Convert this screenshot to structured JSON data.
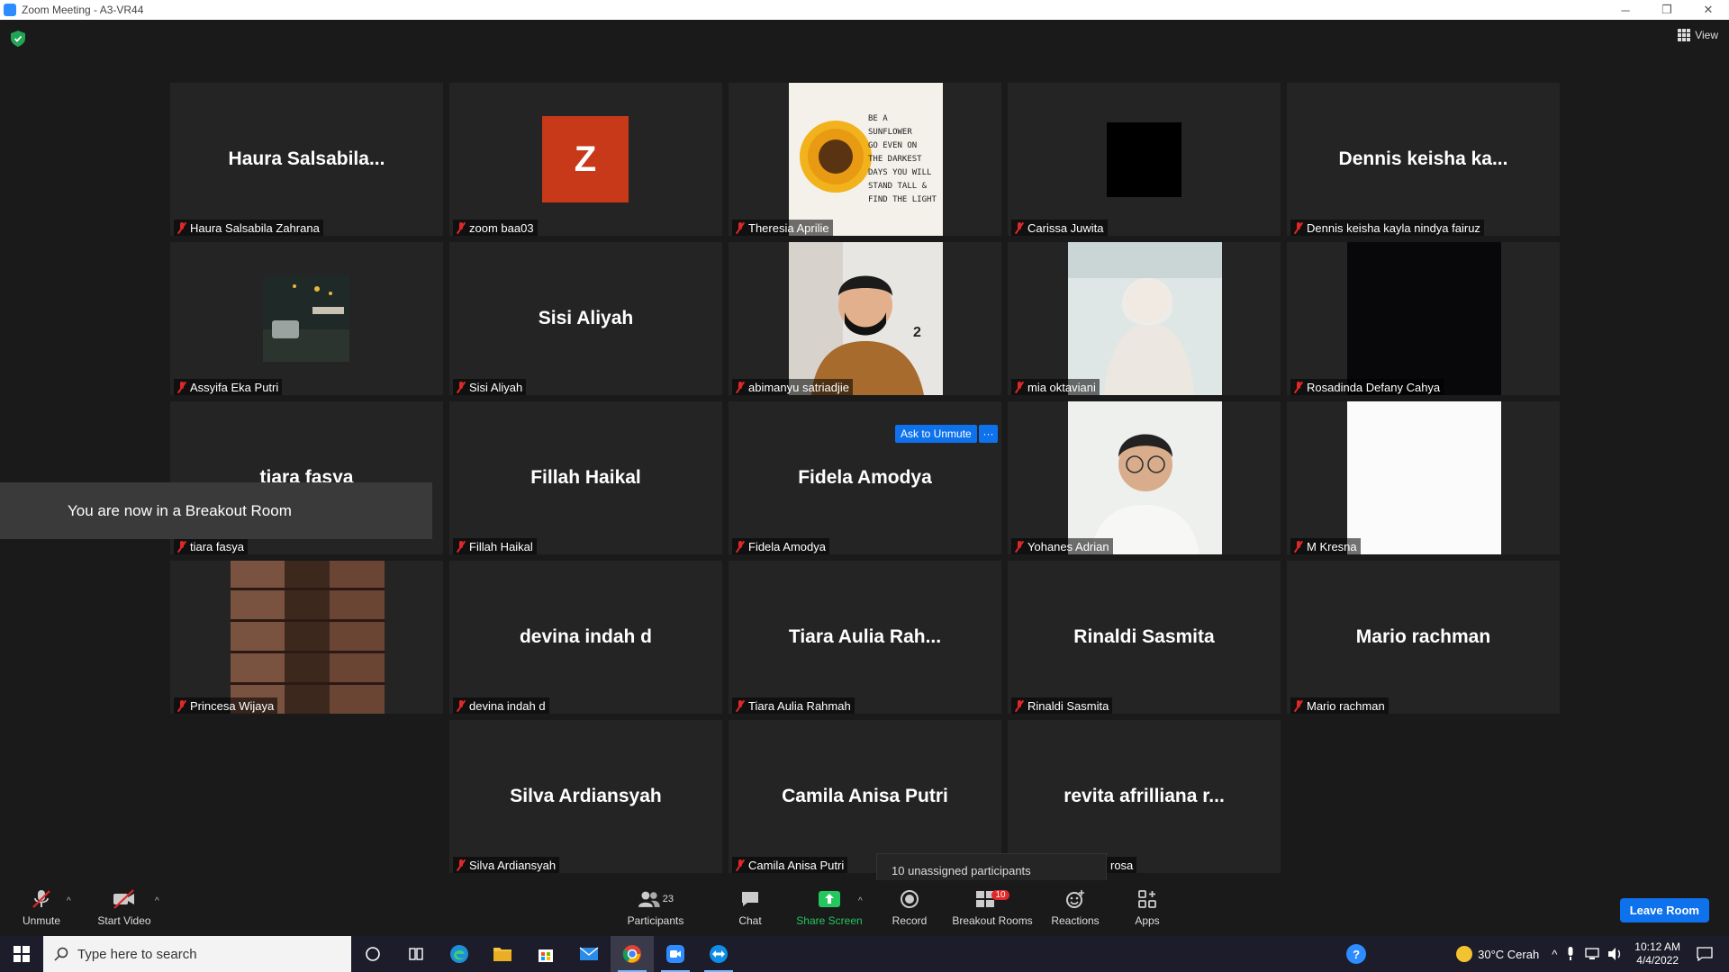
{
  "window": {
    "title": "Zoom Meeting - A3-VR44",
    "minimize": "─",
    "restore": "❐",
    "close": "✕"
  },
  "view_button": {
    "label": "View"
  },
  "tiles": [
    {
      "name": "Haura Salsabila Zahrana",
      "big": "Haura Salsabila..."
    },
    {
      "name": "zoom baa03",
      "avatar_letter": "Z"
    },
    {
      "name": "Theresia Aprilie",
      "image": "sunflower quote",
      "quote_lines": [
        "BE A",
        "SUNFLOWER",
        "GO EVEN ON",
        "THE DARKEST",
        "DAYS YOU WILL",
        "STAND TALL &",
        "FIND THE LIGHT"
      ]
    },
    {
      "name": "Carissa Juwita"
    },
    {
      "name": "Dennis keisha kayla nindya fairuz",
      "big": "Dennis keisha ka..."
    },
    {
      "name": "Assyifa Eka Putri",
      "image": "street photo"
    },
    {
      "name": "Sisi Aliyah",
      "big": "Sisi Aliyah"
    },
    {
      "name": "abimanyu satriadjie",
      "image": "masked person",
      "number": "2"
    },
    {
      "name": "mia oktaviani",
      "image": "person in hijab"
    },
    {
      "name": "Rosadinda Defany Cahya",
      "image": "dark"
    },
    {
      "name": "tiara fasya",
      "big": "tiara fasya"
    },
    {
      "name": "Fillah Haikal",
      "big": "Fillah Haikal"
    },
    {
      "name": "Fidela Amodya",
      "big": "Fidela Amodya"
    },
    {
      "name": "Yohanes Adrian",
      "image": "person with glasses"
    },
    {
      "name": "M Kresna",
      "image": "white"
    },
    {
      "name": "Princesa Wijaya",
      "image": "bookshelves"
    },
    {
      "name": "devina indah d",
      "big": "devina indah d"
    },
    {
      "name": "Tiara Aulia Rahmah",
      "big": "Tiara Aulia Rah..."
    },
    {
      "name": "Rinaldi Sasmita",
      "big": "Rinaldi Sasmita"
    },
    {
      "name": "Mario rachman",
      "big": "Mario rachman"
    },
    {
      "name": "Silva Ardiansyah",
      "big": "Silva Ardiansyah"
    },
    {
      "name": "Camila Anisa Putri",
      "big": "Camila Anisa Putri"
    },
    {
      "name": "rosa",
      "big": "revita afrilliana r..."
    }
  ],
  "breakout_toast": "You are now in a Breakout Room",
  "ask_to_unmute": "Ask to Unmute",
  "more": "···",
  "unassigned_tip": "10 unassigned participants",
  "toolbar": {
    "unmute": "Unmute",
    "start_video": "Start Video",
    "participants": "Participants",
    "participants_count": "23",
    "chat": "Chat",
    "share_screen": "Share Screen",
    "record": "Record",
    "breakout_rooms": "Breakout Rooms",
    "breakout_badge": "10",
    "reactions": "Reactions",
    "apps": "Apps",
    "leave_room": "Leave Room",
    "caret": "^"
  },
  "taskbar": {
    "search_placeholder": "Type here to search",
    "weather": "30°C  Cerah",
    "time": "10:12 AM",
    "date": "4/4/2022"
  },
  "colors": {
    "accent": "#0e72ed",
    "mute_red": "#e02828",
    "share_green": "#24c65e",
    "badge_red": "#e02828"
  }
}
